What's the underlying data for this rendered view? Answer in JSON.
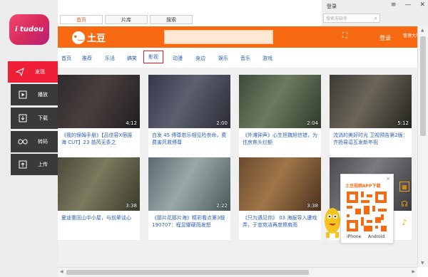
{
  "app": {
    "logo_text": "i tudou"
  },
  "sidebar": {
    "items": [
      {
        "label": "发现",
        "icon": "send-icon",
        "active": true
      },
      {
        "label": "播放",
        "icon": "play-icon",
        "active": false
      },
      {
        "label": "下载",
        "icon": "download-icon",
        "active": false
      },
      {
        "label": "转码",
        "icon": "infinity-icon",
        "active": false
      },
      {
        "label": "上传",
        "icon": "upload-icon",
        "active": false
      }
    ]
  },
  "tabs": [
    {
      "label": "首页",
      "active": true
    },
    {
      "label": "片库",
      "active": false
    },
    {
      "label": "搜索",
      "active": false
    }
  ],
  "window": {
    "login_label": "登录",
    "search_placeholder": "搜索无缺手"
  },
  "header": {
    "logo_text": "土豆",
    "login_label": "登录",
    "manage_label": "管理大厅"
  },
  "categories": [
    {
      "label": "首页",
      "active": false
    },
    {
      "label": "推荐",
      "active": false
    },
    {
      "label": "乐活",
      "active": false
    },
    {
      "label": "搞笑",
      "active": false
    },
    {
      "label": "影视",
      "active": true
    },
    {
      "label": "动漫",
      "active": false
    },
    {
      "label": "身边",
      "active": false
    },
    {
      "label": "娱乐",
      "active": false
    },
    {
      "label": "音乐",
      "active": false
    },
    {
      "label": "游戏",
      "active": false
    }
  ],
  "videos": [
    {
      "duration": "4:12",
      "title": "《我的保姆手册》【吕佳容X宿振海 CUT】23 苗芮无条之"
    },
    {
      "duration": "2:00",
      "title": "白发 45 傅尊若乐相见险丧命，费费害死救傅尊"
    },
    {
      "duration": "2:04",
      "title": "《外滩钟声》心生担魏旭信错，为住房焦头烂额"
    },
    {
      "duration": "5:12",
      "title": "流淌的美好时光 卫视预告第2版：齐扬易逗互发新年祝"
    },
    {
      "duration": "3:38",
      "title": "夏迪重回山中小屋，与前辈谈心"
    },
    {
      "duration": "2:22",
      "title": "《那片花那片海》精彩看点第3版190707：程显娜硬而发怒"
    },
    {
      "duration": "3:38",
      "title": "《只为遇见你》 03 海报导入遭戏弄，于宣宛洁再度擦肩而"
    },
    {
      "duration": "",
      "title": ""
    }
  ],
  "qr_panel": {
    "title": "土豆视频APP下载",
    "close": "×",
    "ios_label": "iPhone",
    "android_label": "Android"
  },
  "colors": {
    "brand_orange": "#f76a12",
    "sidebar_active": "#f01f38",
    "sidebar_item": "#3a3a3a",
    "link_blue": "#2b5fb8"
  }
}
